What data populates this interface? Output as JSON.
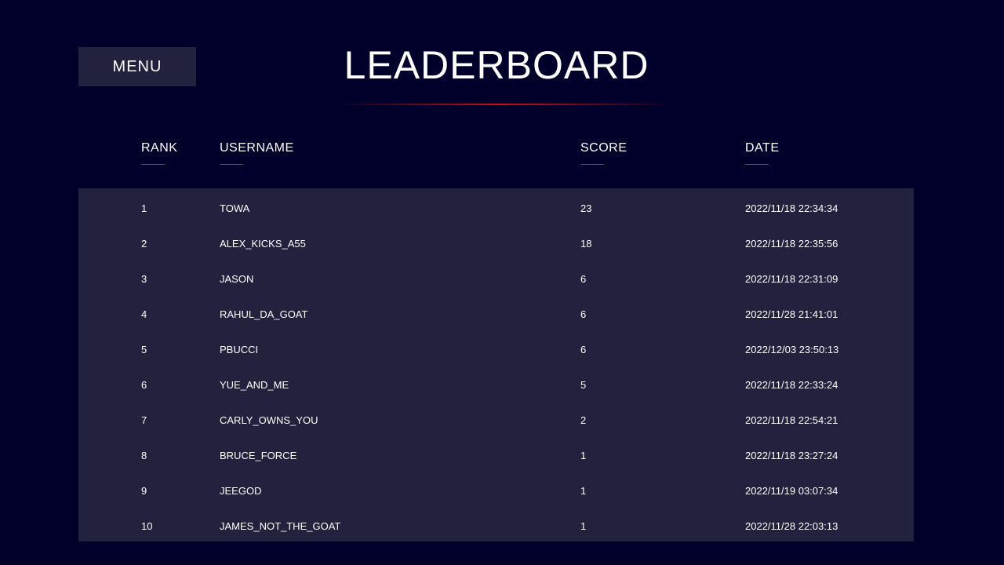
{
  "menu": {
    "label": "MENU"
  },
  "page": {
    "title": "LEADERBOARD"
  },
  "columns": {
    "rank": "RANK",
    "username": "USERNAME",
    "score": "SCORE",
    "date": "DATE"
  },
  "rows": [
    {
      "rank": "1",
      "username": "TOWA",
      "score": "23",
      "date": "2022/11/18 22:34:34"
    },
    {
      "rank": "2",
      "username": "ALEX_KICKS_A55",
      "score": "18",
      "date": "2022/11/18 22:35:56"
    },
    {
      "rank": "3",
      "username": "JASON",
      "score": "6",
      "date": "2022/11/18 22:31:09"
    },
    {
      "rank": "4",
      "username": "RAHUL_DA_GOAT",
      "score": "6",
      "date": "2022/11/28 21:41:01"
    },
    {
      "rank": "5",
      "username": "PBUCCI",
      "score": "6",
      "date": "2022/12/03 23:50:13"
    },
    {
      "rank": "6",
      "username": "YUE_AND_ME",
      "score": "5",
      "date": "2022/11/18 22:33:24"
    },
    {
      "rank": "7",
      "username": "CARLY_OWNS_YOU",
      "score": "2",
      "date": "2022/11/18 22:54:21"
    },
    {
      "rank": "8",
      "username": "BRUCE_FORCE",
      "score": "1",
      "date": "2022/11/18 23:27:24"
    },
    {
      "rank": "9",
      "username": "JEEGOD",
      "score": "1",
      "date": "2022/11/19 03:07:34"
    },
    {
      "rank": "10",
      "username": "JAMES_NOT_THE_GOAT",
      "score": "1",
      "date": "2022/11/28 22:03:13"
    }
  ],
  "colors": {
    "background": "#00002a",
    "panel": "#22223f",
    "accent": "#e01414",
    "text": "#ffffff"
  }
}
